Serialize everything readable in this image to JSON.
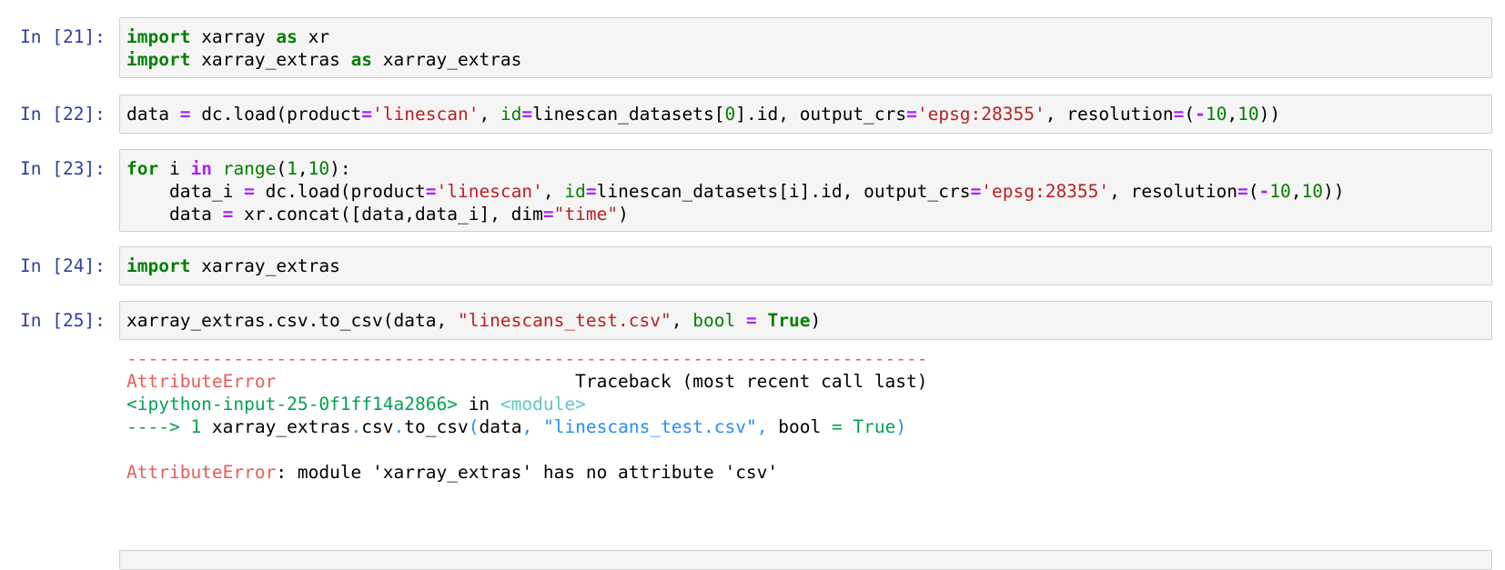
{
  "cells": [
    {
      "prompt": "In [21]:",
      "lines": [
        [
          "import",
          " xarray ",
          "as",
          " xr"
        ],
        [
          "import",
          " xarray_extras ",
          "as",
          " xarray_extras"
        ]
      ]
    },
    {
      "prompt": "In [22]:",
      "line": {
        "t1": "data ",
        "eq1": "=",
        "t2": " dc.load(product",
        "eq2": "=",
        "s1": "'linescan'",
        "t3": ", ",
        "k1": "id",
        "eq3": "=",
        "t4": "linescan_datasets[",
        "n1": "0",
        "t5": "].id, output_crs",
        "eq4": "=",
        "s2": "'epsg:28355'",
        "t6": ", resolution",
        "eq5": "=",
        "t7": "(",
        "m1": "-",
        "n2": "10",
        "t8": ",",
        "n3": "10",
        "t9": "))"
      }
    },
    {
      "prompt": "In [23]:",
      "line1": {
        "kw1": "for",
        "t1": " i ",
        "kw2": "in",
        "t2": " ",
        "b1": "range",
        "t3": "(",
        "n1": "1",
        "t4": ",",
        "n2": "10",
        "t5": "):"
      },
      "line2": {
        "t1": "    data_i ",
        "eq1": "=",
        "t2": " dc.load(product",
        "eq2": "=",
        "s1": "'linescan'",
        "t3": ", ",
        "k1": "id",
        "eq3": "=",
        "t4": "linescan_datasets[i].id, output_crs",
        "eq4": "=",
        "s2": "'epsg:28355'",
        "t5": ", resolution",
        "eq5": "=",
        "t6": "(",
        "m1": "-",
        "n1": "10",
        "t7": ",",
        "n2": "10",
        "t8": "))"
      },
      "line3": {
        "t1": "    data ",
        "eq1": "=",
        "t2": " xr.concat([data,data_i], dim",
        "eq2": "=",
        "s1": "\"time\"",
        "t3": ")"
      }
    },
    {
      "prompt": "In [24]:",
      "line": {
        "kw1": "import",
        "t1": " xarray_extras"
      }
    },
    {
      "prompt": "In [25]:",
      "line": {
        "t1": "xarray_extras.csv.to_csv(data, ",
        "s1": "\"linescans_test.csv\"",
        "t2": ", ",
        "k1": "bool",
        "t3": " ",
        "eq1": "=",
        "t4": " ",
        "kw1": "True",
        "t5": ")"
      },
      "traceback": {
        "dashes": "---------------------------------------------------------------------------",
        "error_name": "AttributeError",
        "header_right": "                            Traceback (most recent call last)",
        "input_ref": "<ipython-input-25-0f1ff14a2866>",
        "in_word": " in ",
        "module_ref": "<module>",
        "arrow": "----> 1 ",
        "call_a": "xarray_extras",
        "dot1": ".",
        "call_b": "csv",
        "dot2": ".",
        "call_c": "to_csv",
        "paren_open": "(",
        "arg_a": "data",
        "comma1": ", ",
        "arg_s": "\"linescans_test.csv\"",
        "comma2": ", ",
        "arg_k": "bool ",
        "arg_eq": "=",
        "arg_v": " True",
        "paren_close": ")",
        "final_name": "AttributeError",
        "final_msg": ": module 'xarray_extras' has no attribute 'csv'"
      }
    }
  ]
}
